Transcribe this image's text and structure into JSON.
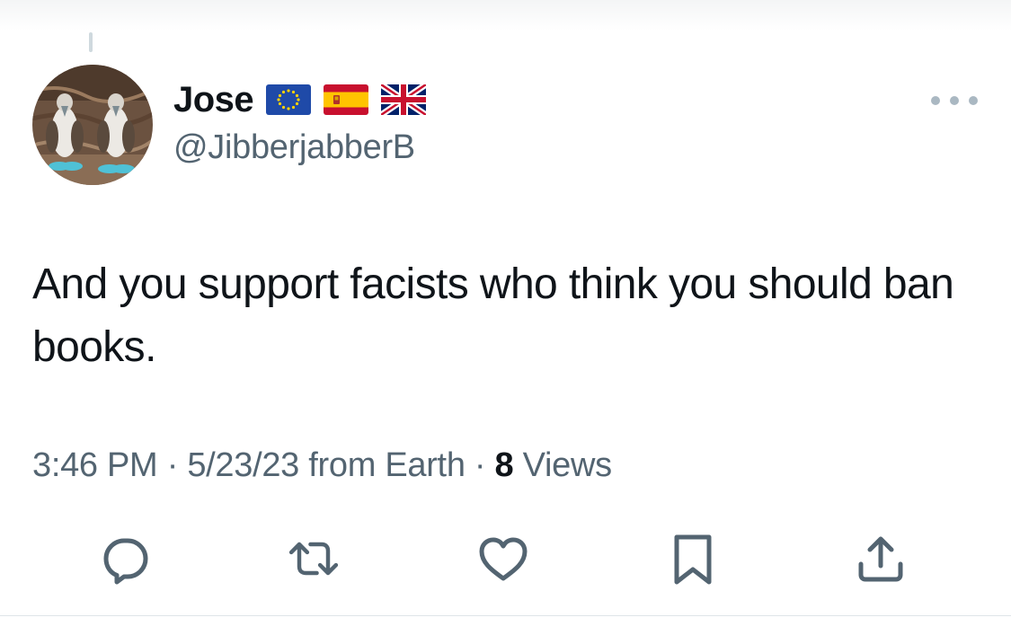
{
  "tweet": {
    "author": {
      "display_name": "Jose",
      "handle": "@JibberjabberB",
      "flags": [
        "eu-flag",
        "spain-flag",
        "uk-flag"
      ]
    },
    "text": "And you support facists who think you should ban books.",
    "time": "3:46 PM",
    "date": "5/23/23",
    "source": "from Earth",
    "views_count": "8",
    "views_label": "Views",
    "separator": "·"
  },
  "actions": [
    {
      "icon": "reply-icon"
    },
    {
      "icon": "retweet-icon"
    },
    {
      "icon": "like-icon"
    },
    {
      "icon": "bookmark-icon"
    },
    {
      "icon": "share-icon"
    }
  ],
  "colors": {
    "text_primary": "#0f1419",
    "text_secondary": "#536471",
    "icon": "#536471",
    "divider": "#dfe4e8"
  }
}
